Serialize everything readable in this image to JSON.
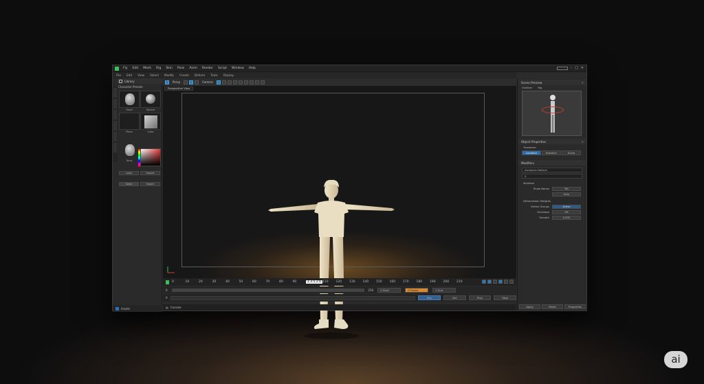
{
  "menubar": {
    "items": [
      "Fly",
      "Edit",
      "Mesh",
      "Rig",
      "Skin",
      "Pose",
      "Anim",
      "Render",
      "Script",
      "Window",
      "Help"
    ],
    "right_icons": [
      "minimize-icon",
      "maximize-icon",
      "close-icon"
    ]
  },
  "toolbar2": {
    "items": [
      "File",
      "Edit",
      "View",
      "Select",
      "Modify",
      "Create",
      "Deform",
      "Tools",
      "Display"
    ]
  },
  "left_panel": {
    "title": "Library",
    "subtitle": "Character Presets",
    "thumbs": [
      {
        "label": "Head"
      },
      {
        "label": "Sphere"
      },
      {
        "label": "Plane"
      },
      {
        "label": "Cube"
      },
      {
        "label": "Torso"
      },
      {
        "label": "Color"
      }
    ],
    "buttons": [
      "Load",
      "Import",
      "Save",
      "Export"
    ],
    "footer": "Assets"
  },
  "viewport": {
    "tab_label": "Perspective View",
    "toolbar_label": "Persp",
    "camera_label": "Camera"
  },
  "timeline": {
    "ticks": [
      "0",
      "10",
      "20",
      "30",
      "40",
      "50",
      "60",
      "70",
      "80",
      "90",
      "100",
      "110",
      "120",
      "130",
      "140",
      "150",
      "160",
      "170",
      "180",
      "190",
      "200",
      "210"
    ],
    "current_frame": "1 3 5 2 6"
  },
  "transport": {
    "start": "0",
    "end": "250",
    "box1": "0 Start",
    "box2": "0 Frame",
    "box3": "1 End"
  },
  "bottom_row": {
    "field_label": "0",
    "buttons": [
      "Key",
      "Set",
      "Play",
      "Stop"
    ]
  },
  "status": {
    "label": "Console"
  },
  "right_panel": {
    "preview_title": "Scene Preview",
    "preview_subtitle": "Outliner",
    "preview_tab": "Rig",
    "section1_title": "Object Properties",
    "section1_sub": "Transform",
    "section1_buttons": [
      "Location",
      "Rotation",
      "Scale"
    ],
    "section2_title": "Modifiers",
    "field1": "Armature Deform",
    "field2": "0",
    "group1_title": "Skeleton",
    "group1_rows": [
      {
        "label": "Show Bones",
        "value": "Yes"
      },
      {
        "label": "",
        "value": "Auto"
      }
    ],
    "group2_title": "Deformation Weights",
    "group2_rows": [
      {
        "label": "Vertex Groups",
        "value": "Active"
      },
      {
        "label": "Envelope",
        "value": "Off"
      },
      {
        "label": "Smooth",
        "value": "0.500"
      }
    ],
    "footer": [
      "Apply",
      "Reset",
      "Properties"
    ]
  },
  "badge": {
    "label": "ai"
  }
}
